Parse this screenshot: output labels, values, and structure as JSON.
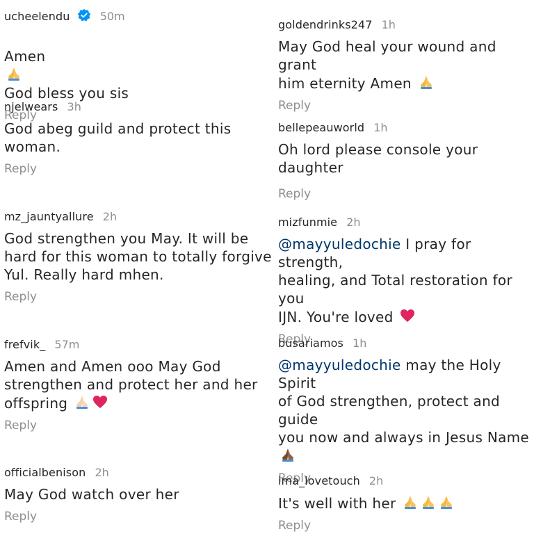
{
  "left": [
    {
      "username": "ucheelendu",
      "verified": true,
      "time": "50m",
      "text": "Amen",
      "text_after": "God bless you sis",
      "reply": "Reply"
    },
    {
      "username": "njelwears",
      "time": "3h",
      "text": "God abeg guild and protect this\nwoman.",
      "reply": "Reply"
    },
    {
      "username": "mz_jauntyallure",
      "time": "2h",
      "text": "God strengthen you May. It will be\nhard for this woman to totally forgive\nYul. Really hard mhen.",
      "reply": "Reply"
    },
    {
      "username": "frefvik_",
      "time": "57m",
      "text": "Amen and Amen ooo May God\nstrengthen and protect her and her\noffspring",
      "reply": "Reply"
    },
    {
      "username": "officialbenison",
      "time": "2h",
      "text": "May God watch over her",
      "reply": "Reply"
    }
  ],
  "right": [
    {
      "username": "goldendrinks247",
      "time": "1h",
      "text": "May God heal your wound and grant\nhim eternity Amen",
      "reply": "Reply"
    },
    {
      "username": "bellepeauworld",
      "time": "1h",
      "text": "Oh lord please console your daughter",
      "reply": "Reply"
    },
    {
      "username": "mizfunmie",
      "time": "2h",
      "mention": "@mayyuledochie",
      "text": " I pray for strength,\nhealing, and Total restoration for you\nIJN. You're loved",
      "reply": "Reply"
    },
    {
      "username": "busariamos",
      "time": "1h",
      "mention": "@mayyuledochie",
      "text": " may the Holy Spirit\nof God strengthen, protect and guide\nyou now and always in Jesus Name",
      "reply": "Reply"
    },
    {
      "username": "ima_lovetouch",
      "time": "2h",
      "text": "It's well with her",
      "reply": "Reply"
    }
  ],
  "colors": {
    "text": "#262626",
    "meta": "#8e8e8e",
    "mention": "#00376b",
    "verified": "#0095f6",
    "divider": "#8f2c6b",
    "heart": "#e0245e"
  }
}
